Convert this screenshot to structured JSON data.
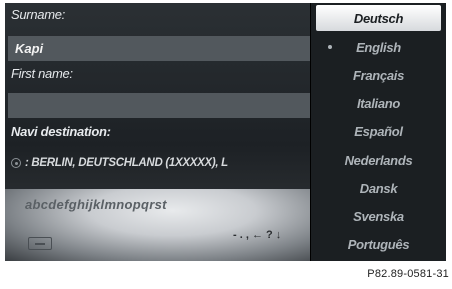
{
  "form": {
    "surname_label": "Surname:",
    "surname_value": "Kapi",
    "first_name_label": "First name:",
    "first_name_value": "",
    "navi_label": "Navi destination:",
    "navi_value": ": BERLIN, DEUTSCHLAND (1XXXXX), L"
  },
  "keyboard": {
    "characters": "abcdefghijklmnopqrst",
    "punctuation": "- . , ← ? ↓"
  },
  "language_menu": {
    "items": [
      {
        "label": "Deutsch"
      },
      {
        "label": "English"
      },
      {
        "label": "Français"
      },
      {
        "label": "Italiano"
      },
      {
        "label": "Español"
      },
      {
        "label": "Nederlands"
      },
      {
        "label": "Dansk"
      },
      {
        "label": "Svenska"
      },
      {
        "label": "Português"
      }
    ],
    "selected_index": 0,
    "current_index": 1
  },
  "footer": {
    "reference": "P82.89-0581-31"
  },
  "icons": {
    "destination": "destination-pin-icon",
    "backspace": "backspace-key-icon",
    "current_marker": "bullet-icon"
  },
  "colors": {
    "background": "#1b1f22",
    "field": "#52585d",
    "highlight": "#ffffff",
    "text": "#e6e9ec"
  }
}
